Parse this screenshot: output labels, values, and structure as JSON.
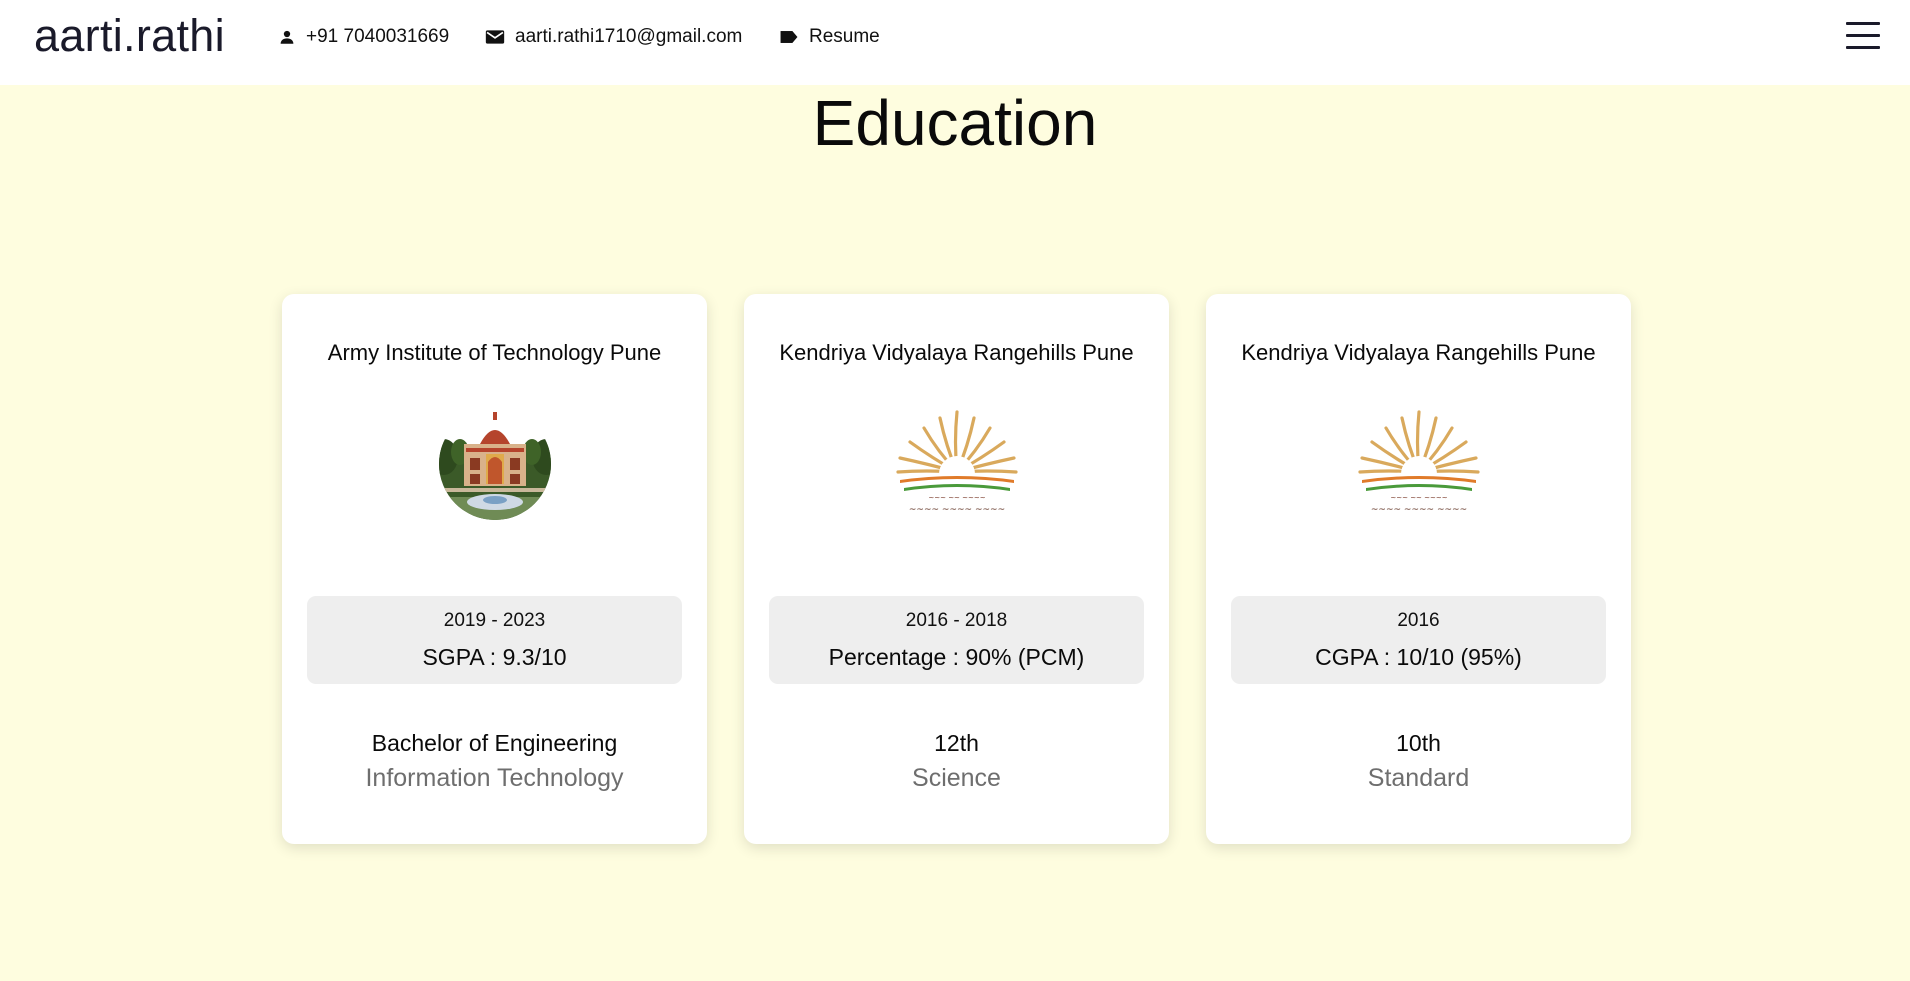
{
  "nav": {
    "brand": "aarti.rathi",
    "phone": "+91 7040031669",
    "email": "aarti.rathi1710@gmail.com",
    "resume": "Resume",
    "icons": [
      "person-icon",
      "mail-icon",
      "label-icon",
      "menu-icon"
    ]
  },
  "section": {
    "title": "Education"
  },
  "cards": [
    {
      "school": "Army Institute of Technology Pune",
      "logo": "campus-building-image",
      "years": "2019 - 2023",
      "score": "SGPA : 9.3/10",
      "degree": "Bachelor of Engineering",
      "field": "Information Technology"
    },
    {
      "school": "Kendriya Vidyalaya Rangehills Pune",
      "logo": "kv-sunburst-logo",
      "years": "2016 - 2018",
      "score": "Percentage : 90% (PCM)",
      "degree": "12th",
      "field": "Science"
    },
    {
      "school": "Kendriya Vidyalaya Rangehills Pune",
      "logo": "kv-sunburst-logo",
      "years": "2016",
      "score": "CGPA : 10/10 (95%)",
      "degree": "10th",
      "field": "Standard"
    }
  ],
  "colors": {
    "page_background": "#fefddf",
    "card_background": "#ffffff",
    "info_box": "#eeeeee",
    "muted_text": "#6e6e6e",
    "logo_saffron": "#e07b2a",
    "logo_green": "#4a9a3a",
    "logo_gold": "#d9a95c"
  }
}
